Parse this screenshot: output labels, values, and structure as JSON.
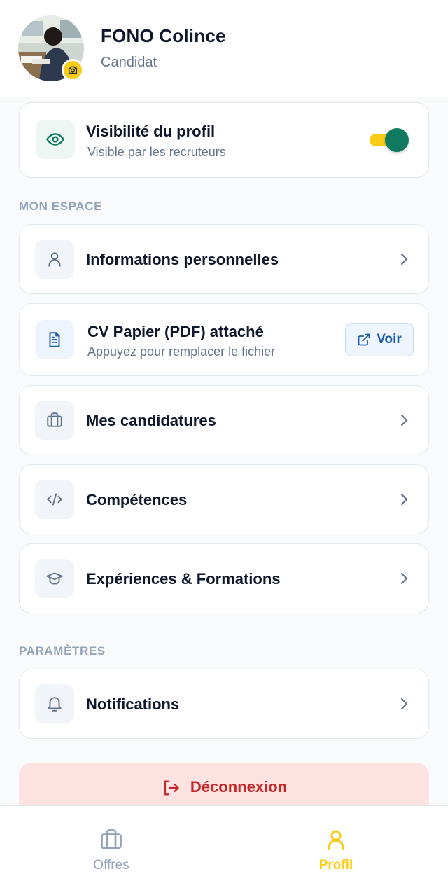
{
  "profile": {
    "name": "FONO Colince",
    "role": "Candidat"
  },
  "visibility": {
    "title": "Visibilité du profil",
    "subtitle": "Visible par les recruteurs",
    "enabled": true
  },
  "sections": {
    "mon_espace": "MON ESPACE",
    "parametres": "PARAMÈTRES"
  },
  "menu": {
    "infos": "Informations personnelles",
    "cv_title": "CV Papier (PDF) attaché",
    "cv_sub": "Appuyez pour remplacer le fichier",
    "cv_button": "Voir",
    "candidatures": "Mes candidatures",
    "competences": "Compétences",
    "experiences": "Expériences & Formations",
    "notifications": "Notifications"
  },
  "logout": "Déconnexion",
  "nav": {
    "offres": "Offres",
    "profil": "Profil",
    "active": "profil"
  },
  "colors": {
    "accent": "#facc15",
    "primary_green": "#0f7a5f",
    "danger": "#c62828",
    "link_blue": "#1e5fa8"
  },
  "icons": {
    "camera": "camera-icon",
    "visibility": "eye-icon",
    "infos": "user-icon",
    "cv": "document-icon",
    "open": "external-link-icon",
    "candidatures": "briefcase-icon",
    "competences": "code-icon",
    "experiences": "graduation-cap-icon",
    "notifications": "bell-icon",
    "chevron": "chevron-right-icon",
    "logout": "logout-icon"
  }
}
